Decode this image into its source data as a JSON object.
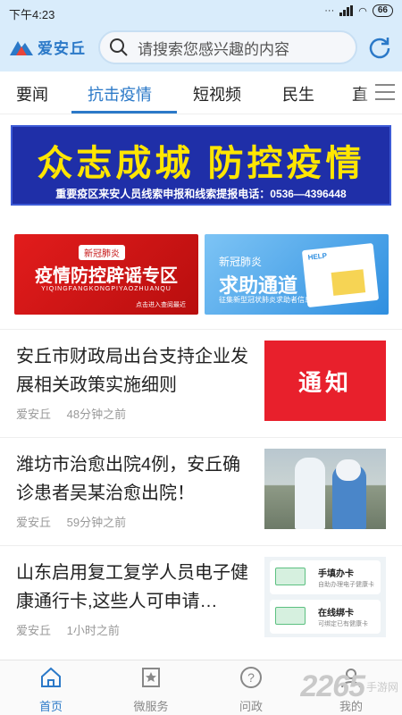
{
  "status": {
    "time": "下午4:23",
    "battery": "66"
  },
  "header": {
    "app_name": "爱安丘",
    "search_placeholder": "请搜索您感兴趣的内容"
  },
  "tabs": [
    {
      "label": "要闻",
      "active": false
    },
    {
      "label": "抗击疫情",
      "active": true
    },
    {
      "label": "短视频",
      "active": false
    },
    {
      "label": "民生",
      "active": false
    },
    {
      "label": "直",
      "active": false
    }
  ],
  "banner": {
    "main": "众志成城  防控疫情",
    "sub": "重要疫区来安人员线索申报和线索提报电话：0536—4396448"
  },
  "promo": [
    {
      "tag": "新冠肺炎",
      "title": "疫情防控辟谣专区",
      "pinyin": "YIQINGFANGKONGPIYAOZHUANQU",
      "small": "点击进入查阅最近"
    },
    {
      "tag": "新冠肺炎",
      "title": "求助通道",
      "small": "征集新型冠状肺炎求助者信息",
      "card_label": "HELP"
    }
  ],
  "news": [
    {
      "title": "安丘市财政局出台支持企业发展相关政策实施细则",
      "source": "爱安丘",
      "time": "48分钟之前",
      "thumb_text": "通知"
    },
    {
      "title": "潍坊市治愈出院4例，安丘确诊患者吴某治愈出院！",
      "source": "爱安丘",
      "time": "59分钟之前"
    },
    {
      "title": "山东启用复工复学人员电子健康通行卡,这些人可申请…",
      "source": "爱安丘",
      "time": "1小时之前",
      "thumb_cards": [
        {
          "label": "手填办卡",
          "desc": "自助办理电子健康卡"
        },
        {
          "label": "在线绑卡",
          "desc": "可绑定已有健康卡"
        }
      ]
    }
  ],
  "bottom_nav": [
    {
      "label": "首页",
      "active": true
    },
    {
      "label": "微服务",
      "active": false
    },
    {
      "label": "问政",
      "active": false
    },
    {
      "label": "我的",
      "active": false
    }
  ],
  "watermark": {
    "number": "2265",
    "suffix": "手游网"
  },
  "colors": {
    "accent": "#2b79c8",
    "banner_bg": "#1f2fa8",
    "banner_text": "#ffe600",
    "red": "#e8202c"
  }
}
